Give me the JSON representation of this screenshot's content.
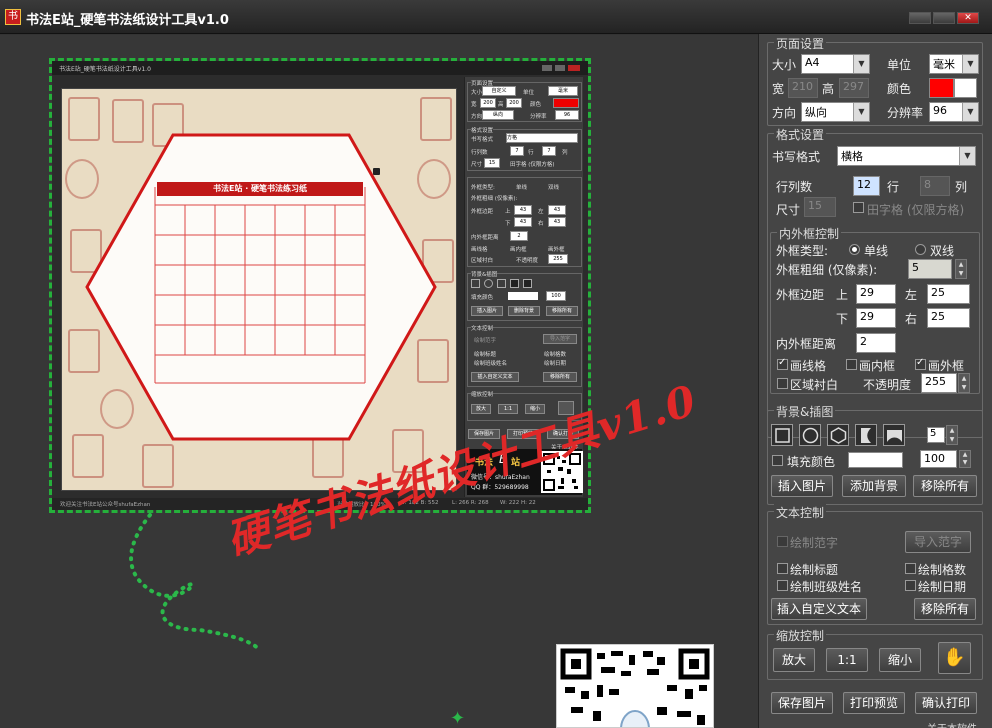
{
  "window": {
    "title": "书法E站_硬笔书法纸设计工具v1.0",
    "app_icon_text": "书",
    "minimize": "",
    "maximize": "",
    "close": "✕"
  },
  "page_settings": {
    "label": "页面设置",
    "size_label": "大小",
    "size_value": "A4",
    "unit_label": "单位",
    "unit_value": "毫米",
    "width_label": "宽",
    "width_value": "210",
    "height_label": "高",
    "height_value": "297",
    "color_label": "颜色",
    "orientation_label": "方向",
    "orientation_value": "纵向",
    "resolution_label": "分辨率",
    "resolution_value": "96",
    "colors": {
      "primary": "#ff0000",
      "secondary": "#ffffff"
    }
  },
  "format_settings": {
    "label": "格式设置",
    "writing_format_label": "书写格式",
    "writing_format_value": "横格",
    "rows_cols_label": "行列数",
    "rows_value": "12",
    "row_label": "行",
    "cols_value": "8",
    "col_label": "列",
    "size_label": "尺寸",
    "size_value": "15",
    "tianzige_label": "田字格 (仅限方格)"
  },
  "frame_control": {
    "label": "内外框控制",
    "frame_type_label": "外框类型:",
    "single_line": "单线",
    "double_line": "双线",
    "thickness_label": "外框粗细 (仅像素):",
    "thickness_value": "5",
    "margin_label": "外框边距",
    "top_label": "上",
    "top_value": "29",
    "left_label": "左",
    "left_value": "25",
    "bottom_label": "下",
    "bottom_value": "29",
    "right_label": "右",
    "right_value": "25",
    "inner_distance_label": "内外框距离",
    "inner_distance_value": "2",
    "draw_grid": "画线格",
    "draw_inner": "画内框",
    "draw_outer": "画外框",
    "area_white": "区域衬白",
    "opacity_label": "不透明度",
    "opacity_value": "255"
  },
  "background": {
    "label": "背景&插图",
    "shape_count": "5",
    "fill_color_label": "填充颜色",
    "fill_value": "100",
    "fill_color": "#ffffff",
    "insert_image": "插入图片",
    "add_background": "添加背景",
    "remove_all": "移除所有"
  },
  "text_control": {
    "label": "文本控制",
    "draw_model": "绘制范字",
    "import_model": "导入范字",
    "draw_title": "绘制标题",
    "draw_grid_count": "绘制格数",
    "draw_class_name": "绘制班级姓名",
    "draw_date": "绘制日期",
    "insert_custom_text": "插入自定义文本",
    "remove_all": "移除所有"
  },
  "zoom_control": {
    "label": "缩放控制",
    "zoom_in": "放大",
    "zoom_reset": "1:1",
    "zoom_out": "缩小",
    "hand": "✋"
  },
  "footer": {
    "save_image": "保存图片",
    "print_preview": "打印预览",
    "confirm_print": "确认打印",
    "about": "关于本软件"
  },
  "preview": {
    "title": "书法E站_硬笔书法纸设计工具v1.0",
    "banner": "书法E站 · 硬笔书法练习纸",
    "status": {
      "welcome": "欢迎关注书法E站公众号shufaEzhan",
      "ratio": "当前缩放比：100%",
      "t": "T: 182 B: 552",
      "l": "L: 266 R: 268",
      "wh": "W: 222 H: 22"
    },
    "page_settings": {
      "label": "页面设置",
      "size_label": "大小",
      "size_value": "自定义",
      "unit_label": "单位",
      "unit_value": "毫米",
      "width_label": "宽",
      "width_value": "200",
      "height_label": "高",
      "height_value": "200",
      "color_label": "颜色",
      "orientation_label": "方向",
      "orientation_value": "纵向",
      "resolution_label": "分辨率",
      "resolution_value": "96"
    },
    "format": {
      "label": "格式设置",
      "writing_format_label": "书写格式",
      "writing_format_value": "方格",
      "rows_cols_label": "行列数",
      "rows_value": "7",
      "row_label": "行",
      "cols_value": "7",
      "col_label": "列",
      "size_label": "尺寸",
      "size_value": "15",
      "tianzige_label": "田字格 (仅限方格)"
    },
    "frame": {
      "frame_type_label": "外框类型:",
      "single": "单线",
      "double": "双线",
      "thickness_label": "外框粗细 (仅像素):",
      "margin_label": "外框边距",
      "top_label": "上",
      "top_value": "43",
      "left_label": "左",
      "left_value": "43",
      "bottom_label": "下",
      "bottom_value": "43",
      "right_label": "右",
      "right_value": "43",
      "inner_label": "内外框距离",
      "inner_value": "2",
      "draw_grid": "画线格",
      "draw_inner": "画内框",
      "draw_outer": "画外框",
      "area_white": "区域衬白",
      "opacity_label": "不透明度",
      "opacity_value": "255"
    },
    "bg": {
      "label": "背景&插图",
      "fill_label": "填充颜色",
      "fill_value": "100",
      "insert": "插入图片",
      "add_bg": "删除背景",
      "remove": "移除所有"
    },
    "text": {
      "label": "文本控制",
      "draw_model": "绘制范字",
      "import_model": "导入范字",
      "draw_title": "绘制标题",
      "draw_count": "绘制格数",
      "draw_class": "绘制班级姓名",
      "draw_date": "绘制日期",
      "insert_text": "插入自定义文本",
      "remove": "移除所有"
    },
    "zoom": {
      "label": "缩放控制",
      "in": "放大",
      "reset": "1:1",
      "out": "缩小"
    },
    "footer": {
      "save": "保存图片",
      "print_preview": "打印预览",
      "confirm_print": "确认打印",
      "about": "关于本软件"
    },
    "brand": {
      "name": "书法",
      "e": "E",
      "station": "站",
      "wechat": "微信号：shufaEzhan",
      "qq": "QQ 群：529689998"
    }
  },
  "promo": {
    "slogan": "硬笔书法纸设计工具v1.0"
  }
}
